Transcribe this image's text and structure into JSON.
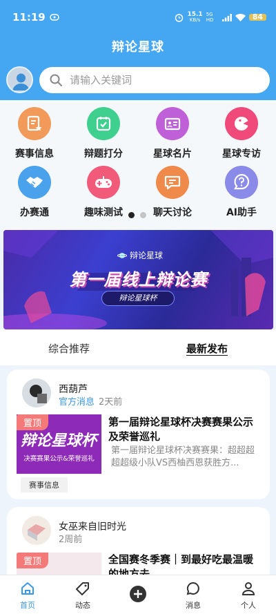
{
  "status": {
    "time": "11:19",
    "speed": "15.1",
    "speed_unit": "KB/s",
    "network": "5G HD",
    "battery": "84"
  },
  "app_title": "辩论星球",
  "search": {
    "placeholder": "请输入关键词"
  },
  "grid_items": [
    {
      "label": "赛事信息",
      "icon": "document-star-icon",
      "color": "#f29a5a"
    },
    {
      "label": "辩题打分",
      "icon": "calendar-check-icon",
      "color": "#3fcf8e"
    },
    {
      "label": "星球名片",
      "icon": "id-card-icon",
      "color": "#c060d8"
    },
    {
      "label": "星球专访",
      "icon": "chat-face-icon",
      "color": "#f04a7a"
    },
    {
      "label": "办赛通",
      "icon": "handshake-icon",
      "color": "#4aa2ec"
    },
    {
      "label": "趣味测试",
      "icon": "gamepad-icon",
      "color": "#f25a7a"
    },
    {
      "label": "聊天讨论",
      "icon": "chat-bubble-icon",
      "color": "#f08a4a"
    },
    {
      "label": "AI助手",
      "icon": "question-bubble-icon",
      "color": "#8a8ae8"
    }
  ],
  "banner": {
    "logo_text": "辩论星球",
    "headline": "第一届线上辩论赛",
    "pill": "辩论星球杯"
  },
  "tabs": [
    {
      "label": "综合推荐"
    },
    {
      "label": "最新发布"
    }
  ],
  "posts": [
    {
      "author": "西葫芦",
      "tag": "官方消息",
      "time": "2天前",
      "pin": "置顶",
      "thumb_text": "辩论星球杯",
      "thumb_sub": "决赛赛果公示&荣誉巡礼",
      "title": "第一届辩论星球杯决赛赛果公示及荣誉巡礼",
      "desc": "第一届辩论星球杯决赛赛果：超超超超超级小队VS西柚西恩获胜方...",
      "category": "赛事信息"
    },
    {
      "author": "女巫来自旧时光",
      "time": "2周前",
      "pin": "置顶",
      "title": "全国赛冬季赛｜到最好吃最温暖的地方去"
    }
  ],
  "bottom_nav": [
    {
      "label": "首页",
      "icon": "home-icon"
    },
    {
      "label": "动态",
      "icon": "tag-icon"
    },
    {
      "label": "",
      "icon": "plus-circle-icon"
    },
    {
      "label": "消息",
      "icon": "message-icon"
    },
    {
      "label": "个人",
      "icon": "person-icon"
    }
  ]
}
